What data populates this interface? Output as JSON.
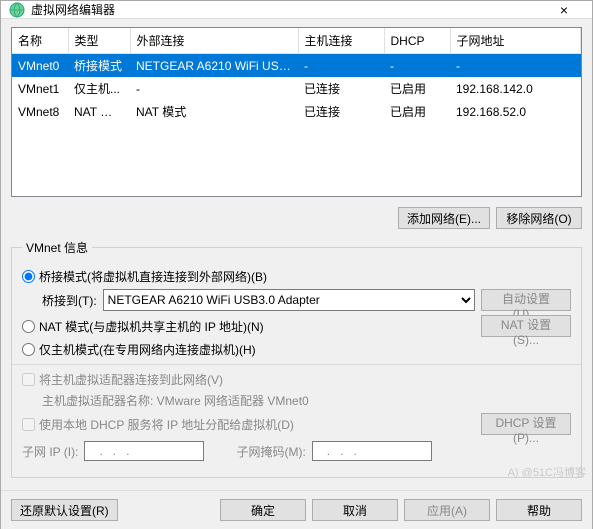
{
  "title": "虚拟网络编辑器",
  "close_glyph": "×",
  "columns": {
    "name": "名称",
    "type": "类型",
    "ext": "外部连接",
    "host": "主机连接",
    "dhcp": "DHCP",
    "subnet": "子网地址"
  },
  "rows": [
    {
      "name": "VMnet0",
      "type": "桥接模式",
      "ext": "NETGEAR A6210 WiFi USB3....",
      "host": "-",
      "dhcp": "-",
      "subnet": "-",
      "selected": true
    },
    {
      "name": "VMnet1",
      "type": "仅主机...",
      "ext": "-",
      "host": "已连接",
      "dhcp": "已启用",
      "subnet": "192.168.142.0"
    },
    {
      "name": "VMnet8",
      "type": "NAT 模式",
      "ext": "NAT 模式",
      "host": "已连接",
      "dhcp": "已启用",
      "subnet": "192.168.52.0"
    }
  ],
  "buttons": {
    "add_network": "添加网络(E)...",
    "remove_network": "移除网络(O)",
    "auto_set": "自动设置(U)...",
    "nat_set": "NAT 设置(S)...",
    "dhcp_set": "DHCP 设置(P)...",
    "restore": "还原默认设置(R)",
    "ok": "确定",
    "cancel": "取消",
    "apply": "应用(A)",
    "help": "帮助"
  },
  "group_title": "VMnet 信息",
  "radios": {
    "bridged": "桥接模式(将虚拟机直接连接到外部网络)(B)",
    "nat": "NAT 模式(与虚拟机共享主机的 IP 地址)(N)",
    "hostonly": "仅主机模式(在专用网络内连接虚拟机)(H)"
  },
  "bridge_to_label": "桥接到(T):",
  "bridge_adapter": "NETGEAR A6210 WiFi USB3.0 Adapter",
  "chk_connect_host": "将主机虚拟适配器连接到此网络(V)",
  "host_adapter_line": "主机虚拟适配器名称: VMware 网络适配器 VMnet0",
  "chk_use_dhcp": "使用本地 DHCP 服务将 IP 地址分配给虚拟机(D)",
  "subnet_ip_label": "子网 IP (I):",
  "subnet_mask_label": "子网掩码(M):",
  "subnet_ip": "   .   .   .   ",
  "subnet_mask": "   .   .   .   ",
  "watermark": "A) @51C冯博客"
}
